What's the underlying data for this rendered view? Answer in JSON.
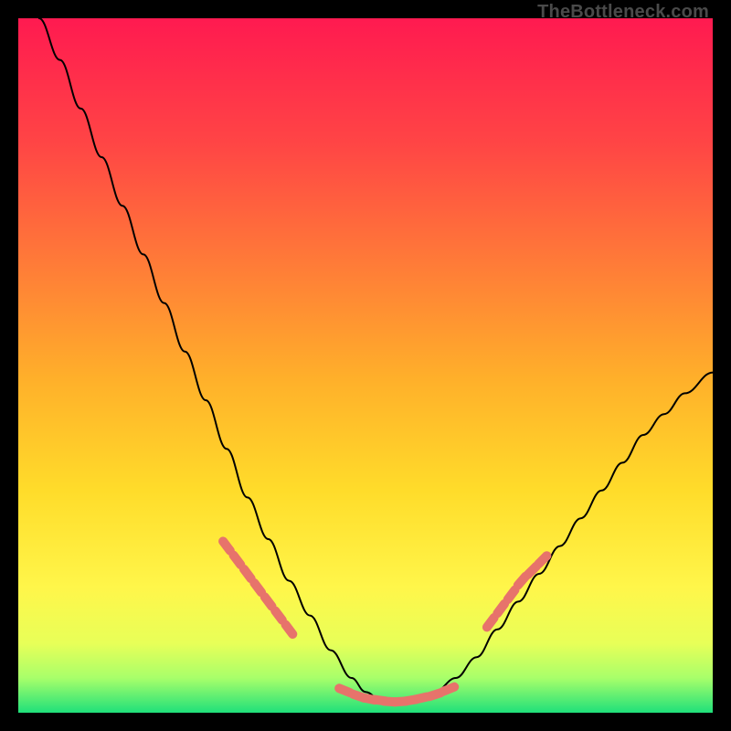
{
  "watermark": "TheBottleneck.com",
  "chart_data": {
    "type": "line",
    "title": "",
    "xlabel": "",
    "ylabel": "",
    "xlim": [
      0,
      100
    ],
    "ylim": [
      0,
      100
    ],
    "grid": false,
    "legend": false,
    "background_gradient": {
      "top_color": "#ff1a50",
      "mid_colors": [
        "#ff6a3a",
        "#ffb02a",
        "#ffe22a",
        "#fff94a"
      ],
      "bottom_color": "#1fe07a"
    },
    "series": [
      {
        "name": "bottleneck-curve",
        "color": "#000000",
        "x": [
          3,
          6,
          9,
          12,
          15,
          18,
          21,
          24,
          27,
          30,
          33,
          36,
          39,
          42,
          45,
          48,
          50,
          52,
          54,
          56,
          58,
          60,
          63,
          66,
          69,
          72,
          75,
          78,
          81,
          84,
          87,
          90,
          93,
          96,
          100
        ],
        "y": [
          100,
          94,
          87,
          80,
          73,
          66,
          59,
          52,
          45,
          38,
          31,
          25,
          19,
          14,
          9,
          5,
          3,
          2,
          1.5,
          1.5,
          2,
          3,
          5,
          8,
          12,
          16,
          20,
          24,
          28,
          32,
          36,
          40,
          43,
          46,
          49
        ]
      }
    ],
    "markers": [
      {
        "name": "dots-left-arm",
        "color": "#e7736b",
        "points": [
          {
            "x": 30,
            "y": 24
          },
          {
            "x": 31.5,
            "y": 22
          },
          {
            "x": 33,
            "y": 20
          },
          {
            "x": 34.5,
            "y": 18
          },
          {
            "x": 36,
            "y": 16
          },
          {
            "x": 37.5,
            "y": 14
          },
          {
            "x": 39,
            "y": 12
          }
        ]
      },
      {
        "name": "dots-valley",
        "color": "#e7736b",
        "points": [
          {
            "x": 47,
            "y": 3.2
          },
          {
            "x": 49,
            "y": 2.4
          },
          {
            "x": 50.5,
            "y": 2.0
          },
          {
            "x": 52,
            "y": 1.8
          },
          {
            "x": 53.5,
            "y": 1.6
          },
          {
            "x": 55,
            "y": 1.6
          },
          {
            "x": 56.5,
            "y": 1.8
          },
          {
            "x": 58,
            "y": 2.1
          },
          {
            "x": 60,
            "y": 2.6
          },
          {
            "x": 62,
            "y": 3.4
          }
        ]
      },
      {
        "name": "dots-right-arm",
        "color": "#e7736b",
        "points": [
          {
            "x": 68,
            "y": 13
          },
          {
            "x": 69.5,
            "y": 15
          },
          {
            "x": 71,
            "y": 17
          },
          {
            "x": 72.5,
            "y": 19
          },
          {
            "x": 74,
            "y": 20.5
          },
          {
            "x": 75.5,
            "y": 22
          }
        ]
      }
    ]
  }
}
